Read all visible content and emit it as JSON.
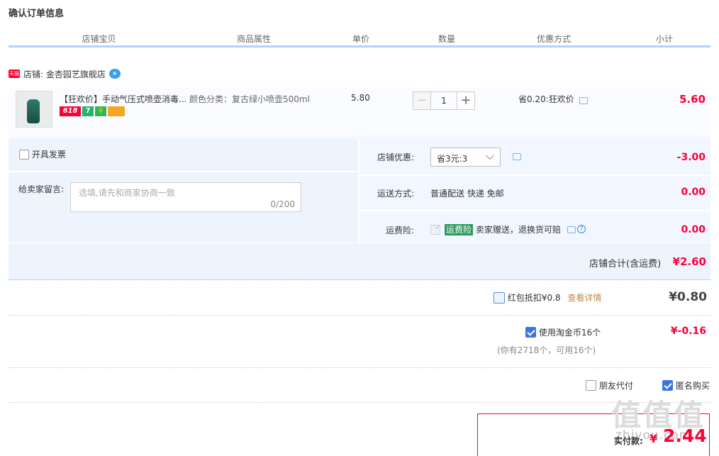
{
  "page_title": "确认订单信息",
  "columns": [
    "店铺宝贝",
    "商品属性",
    "单价",
    "数量",
    "优惠方式",
    "小计"
  ],
  "shop": {
    "badge": "天猫",
    "label": "店铺: 金杏园艺旗舰店"
  },
  "item": {
    "name": "【狂欢价】手动气压式喷壶消毒...",
    "attr": "颜色分类：复古绿小喷壶500ml",
    "unit_price": "5.80",
    "quantity": "1",
    "minus": "−",
    "plus": "+",
    "discount": "省0.20:狂欢价",
    "subtotal": "5.60",
    "tags": [
      "618",
      "7"
    ]
  },
  "invoice_label": "开具发票",
  "memo": {
    "label": "给卖家留言:",
    "placeholder": "选填,请先和商家协商一致",
    "counter": "0/200"
  },
  "shop_discount": {
    "label": "店铺优惠:",
    "selected": "省3元:3",
    "amount": "-3.00"
  },
  "shipping": {
    "label": "运送方式:",
    "value": "普通配送 快递 免邮",
    "amount": "0.00"
  },
  "insurance": {
    "label": "运费险:",
    "badge": "运费险",
    "text": "卖家赠送，退换货可赔",
    "amount": "0.00"
  },
  "shop_total": {
    "label": "店铺合计(含运费)",
    "amount": "¥2.60"
  },
  "red_packet": {
    "label": "红包抵扣¥0.8",
    "link": "查看详情",
    "amount": "¥0.80"
  },
  "coins": {
    "label": "使用淘金币16个",
    "note": "(你有2718个，可用16个)",
    "amount": "¥-0.16"
  },
  "options": {
    "friend_pay": "朋友代付",
    "anonymous": "匿名购买"
  },
  "pay": {
    "label": "实付款:",
    "currency": "¥",
    "amount": "2.44"
  },
  "watermark": {
    "logo": "值值值",
    "url": "zhiyou.com"
  },
  "colors": {
    "accent_red": "#ff0036",
    "header_line": "#b2d1ff",
    "panel_bg": "#eef4fe"
  }
}
